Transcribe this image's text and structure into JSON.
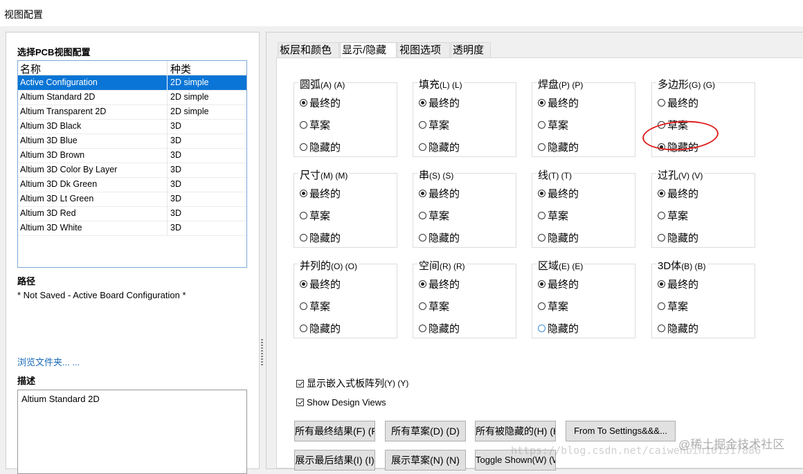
{
  "window": {
    "title": "视图配置"
  },
  "left": {
    "select_label": "选择PCB视图配置",
    "columns": [
      "名称",
      "种类"
    ],
    "rows": [
      {
        "name": "Active Configuration",
        "kind": "2D simple",
        "selected": true
      },
      {
        "name": "Altium Standard 2D",
        "kind": "2D simple"
      },
      {
        "name": "Altium Transparent 2D",
        "kind": "2D simple"
      },
      {
        "name": "Altium 3D Black",
        "kind": "3D"
      },
      {
        "name": "Altium 3D Blue",
        "kind": "3D"
      },
      {
        "name": "Altium 3D Brown",
        "kind": "3D"
      },
      {
        "name": "Altium 3D Color By Layer",
        "kind": "3D"
      },
      {
        "name": "Altium 3D Dk Green",
        "kind": "3D"
      },
      {
        "name": "Altium 3D Lt Green",
        "kind": "3D"
      },
      {
        "name": "Altium 3D Red",
        "kind": "3D"
      },
      {
        "name": "Altium 3D White",
        "kind": "3D"
      }
    ],
    "path_label": "路径",
    "path_value": "* Not Saved - Active Board Configuration *",
    "browse_link": "浏览文件夹... ...",
    "description_label": "描述",
    "description_value": "Altium Standard 2D"
  },
  "tabs": [
    "板层和颜色",
    "显示/隐藏",
    "视图选项",
    "透明度"
  ],
  "active_tab": "显示/隐藏",
  "options": [
    "最终的",
    "草案",
    "隐藏的"
  ],
  "groups": [
    {
      "title": "圆弧",
      "accel": "(A) (A)",
      "selected": "最终的"
    },
    {
      "title": "填充",
      "accel": "(L) (L)",
      "selected": "最终的"
    },
    {
      "title": "焊盘",
      "accel": "(P) (P)",
      "selected": "最终的"
    },
    {
      "title": "多边形",
      "accel": "(G) (G)",
      "selected": "隐藏的"
    },
    {
      "title": "尺寸",
      "accel": "(M) (M)",
      "selected": "最终的"
    },
    {
      "title": "串",
      "accel": "(S) (S)",
      "selected": "最终的"
    },
    {
      "title": "线",
      "accel": "(T) (T)",
      "selected": "最终的"
    },
    {
      "title": "过孔",
      "accel": "(V) (V)",
      "selected": "最终的"
    },
    {
      "title": "并列的",
      "accel": "(O) (O)",
      "selected": "最终的"
    },
    {
      "title": "空间",
      "accel": "(R) (R)",
      "selected": "最终的"
    },
    {
      "title": "区域",
      "accel": "(E) (E)",
      "selected": "最终的"
    },
    {
      "title": "3D体",
      "accel": "(B) (B)",
      "selected": "最终的"
    }
  ],
  "checkboxes": [
    {
      "label": "显示嵌入式板阵列",
      "accel": "(Y) (Y)",
      "checked": true
    },
    {
      "label": "Show Design Views",
      "accel": "",
      "checked": true
    }
  ],
  "buttons_row1": [
    "所有最终结果(F) (F)",
    "所有草案(D) (D)",
    "所有被隐藏的(H) (H)",
    "From To Settings&&&..."
  ],
  "buttons_row2": [
    "展示最后结果(I) (I)",
    "展示草案(N) (N)",
    "Toggle Shown(W) (W)"
  ],
  "watermark": {
    "url": "https://blog.csdn.net/caiwenbin101317886",
    "brand": "@稀土掘金技术社区"
  },
  "colors": {
    "selection": "#0a75d6",
    "annotation_circle": "#e02020",
    "link": "#1a6bb8"
  }
}
